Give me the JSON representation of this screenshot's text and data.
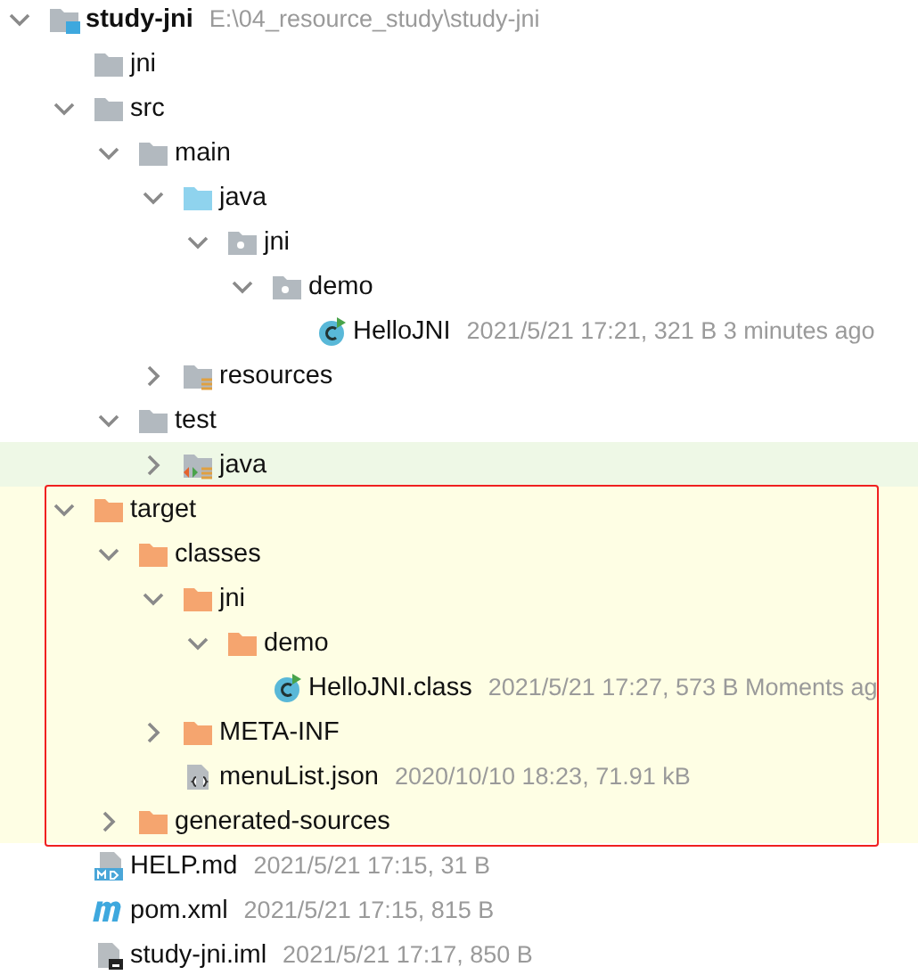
{
  "tree": [
    {
      "name": "study-jni",
      "path": "E:\\04_resource_study\\study-jni",
      "kind": "module",
      "expanded": true,
      "children": [
        {
          "name": "jni",
          "kind": "folder"
        },
        {
          "name": "src",
          "kind": "folder",
          "expanded": true,
          "children": [
            {
              "name": "main",
              "kind": "folder",
              "expanded": true,
              "children": [
                {
                  "name": "java",
                  "kind": "source",
                  "expanded": true,
                  "children": [
                    {
                      "name": "jni",
                      "kind": "package",
                      "expanded": true,
                      "children": [
                        {
                          "name": "demo",
                          "kind": "package",
                          "expanded": true,
                          "children": [
                            {
                              "name": "HelloJNI",
                              "kind": "class",
                              "meta": "2021/5/21 17:21, 321 B 3 minutes ago"
                            }
                          ]
                        }
                      ]
                    }
                  ]
                },
                {
                  "name": "resources",
                  "kind": "resources",
                  "expanded": false
                }
              ]
            },
            {
              "name": "test",
              "kind": "folder",
              "expanded": true,
              "children": [
                {
                  "name": "java",
                  "kind": "testsource",
                  "expanded": false
                }
              ]
            }
          ]
        },
        {
          "name": "target",
          "kind": "excluded",
          "expanded": true,
          "excluded": true,
          "annotated": true,
          "children": [
            {
              "name": "classes",
              "kind": "excluded",
              "expanded": true,
              "children": [
                {
                  "name": "jni",
                  "kind": "excluded",
                  "expanded": true,
                  "children": [
                    {
                      "name": "demo",
                      "kind": "excluded",
                      "expanded": true,
                      "children": [
                        {
                          "name": "HelloJNI.class",
                          "kind": "class",
                          "meta": "2021/5/21 17:27, 573 B Moments ag"
                        }
                      ]
                    }
                  ]
                },
                {
                  "name": "META-INF",
                  "kind": "excluded",
                  "expanded": false
                },
                {
                  "name": "menuList.json",
                  "kind": "json",
                  "meta": "2020/10/10 18:23, 71.91 kB"
                }
              ]
            },
            {
              "name": "generated-sources",
              "kind": "excluded",
              "expanded": false
            }
          ]
        },
        {
          "name": "HELP.md",
          "kind": "markdown",
          "meta": "2021/5/21 17:15, 31 B"
        },
        {
          "name": "pom.xml",
          "kind": "maven",
          "meta": "2021/5/21 17:15, 815 B"
        },
        {
          "name": "study-jni.iml",
          "kind": "iml",
          "meta": "2021/5/21 17:17, 850 B"
        }
      ]
    }
  ]
}
